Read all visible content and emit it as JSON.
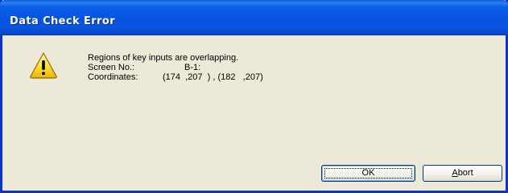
{
  "window": {
    "title": "Data Check Error",
    "title_bar_color": "#0654e0",
    "background_color": "#ece9d8"
  },
  "dialog": {
    "icon": "warning-icon",
    "message": "Regions of key inputs are overlapping.",
    "screen_label": "Screen No.:",
    "screen_value": "B-1:",
    "coordinates_label": "Coordinates:",
    "coordinates_value": "(174  ,207  ) , (182   ,207)"
  },
  "buttons": {
    "ok_label": "OK",
    "abort_mnemonic": "A",
    "abort_rest": "bort"
  }
}
